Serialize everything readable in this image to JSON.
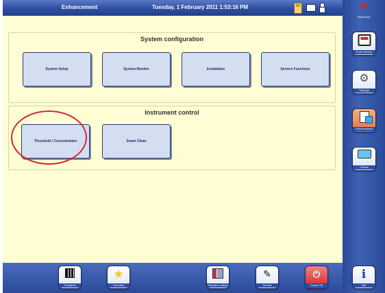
{
  "header": {
    "title": "Enhancement",
    "datetime": "Tuesday, 1 February 2011 1:53:16 PM"
  },
  "sidebar": {
    "user_label": "Supervisor",
    "items": [
      {
        "label": "Front Screen",
        "icon": "monitor-icon"
      },
      {
        "label": "Settings",
        "icon": "gear-icon"
      },
      {
        "label": "Enhancement",
        "icon": "document-icon"
      },
      {
        "label": "Cleans",
        "icon": "clean-icon"
      }
    ]
  },
  "system_configuration": {
    "title": "System configuration",
    "buttons": [
      "System Setup",
      "System Monitor",
      "Installation",
      "Service Functions"
    ]
  },
  "instrument_control": {
    "title": "Instrument control",
    "buttons": [
      "Threshold / Concentration",
      "Smart Clean"
    ]
  },
  "bottom_bar": {
    "items": [
      {
        "label": "Programs",
        "icon": "grid-icon"
      },
      {
        "label": "Favorites",
        "icon": "star-icon"
      },
      {
        "label": "Sample Loading",
        "icon": "sample-icon"
      },
      {
        "label": "Service",
        "icon": "wrench-icon"
      },
      {
        "label": "Power Off",
        "icon": "power-icon"
      },
      {
        "label": "Info",
        "icon": "info-icon"
      }
    ]
  },
  "colors": {
    "header_blue": "#2d4ea0",
    "panel_yellow": "#fffdd4",
    "button_fill": "#d4def1",
    "highlight_red": "#d42631",
    "active_orange": "#e8703f"
  }
}
